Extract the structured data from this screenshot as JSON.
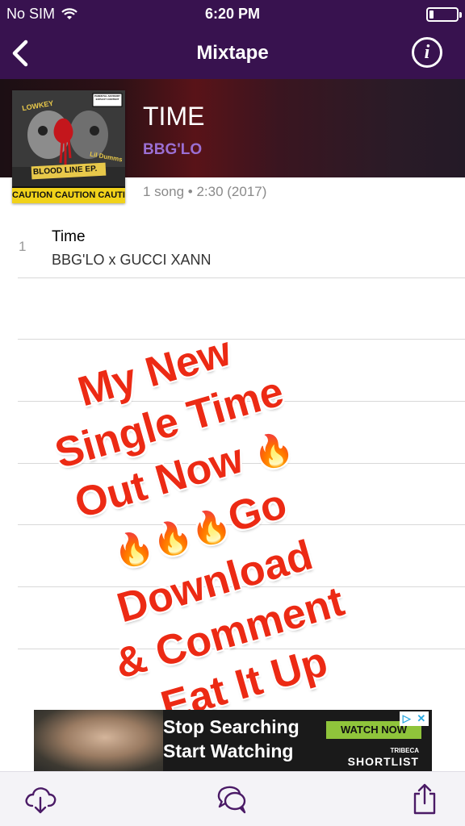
{
  "status_bar": {
    "carrier": "No SIM",
    "time": "6:20 PM",
    "wifi_icon": "wifi-icon",
    "battery_level": 0.15
  },
  "nav": {
    "title": "Mixtape",
    "back_icon": "chevron-left-icon",
    "info_glyph": "i"
  },
  "album": {
    "title": "TIME",
    "artist": "BBG'LO",
    "meta": "1 song • 2:30 (2017)",
    "cover": {
      "top_left_text": "LOWKEY",
      "top_right_text": "Lil Dumms",
      "banner_text": "BLOOD LINE EP.",
      "caution_text": "CAUTION CAUTION CAUTION",
      "advisory_text": "PARENTAL ADVISORY EXPLICIT CONTENT"
    }
  },
  "tracks": [
    {
      "number": "1",
      "title": "Time",
      "artists": "BBG'LO x GUCCI XANN"
    }
  ],
  "overlay_caption": {
    "lines": [
      "My New",
      "Single Time",
      "Out Now",
      "Go",
      "Download",
      "& Comment",
      "Eat It Up"
    ],
    "emoji": "🔥",
    "color": "#ec2a14"
  },
  "ad": {
    "line1": "Stop Searching",
    "line2": "Start Watching",
    "cta": "WATCH NOW",
    "brand_small": "TRIBECA",
    "brand": "SHORTLIST",
    "adchoices_icon": "adchoices-icon",
    "close_glyph": "✕"
  },
  "toolbar": {
    "download_icon": "cloud-download-icon",
    "comments_icon": "comments-icon",
    "share_icon": "share-icon"
  },
  "colors": {
    "nav_bg": "#38124f",
    "artist_purple": "#9b6fd3",
    "toolbar_icon": "#4a1a66"
  }
}
